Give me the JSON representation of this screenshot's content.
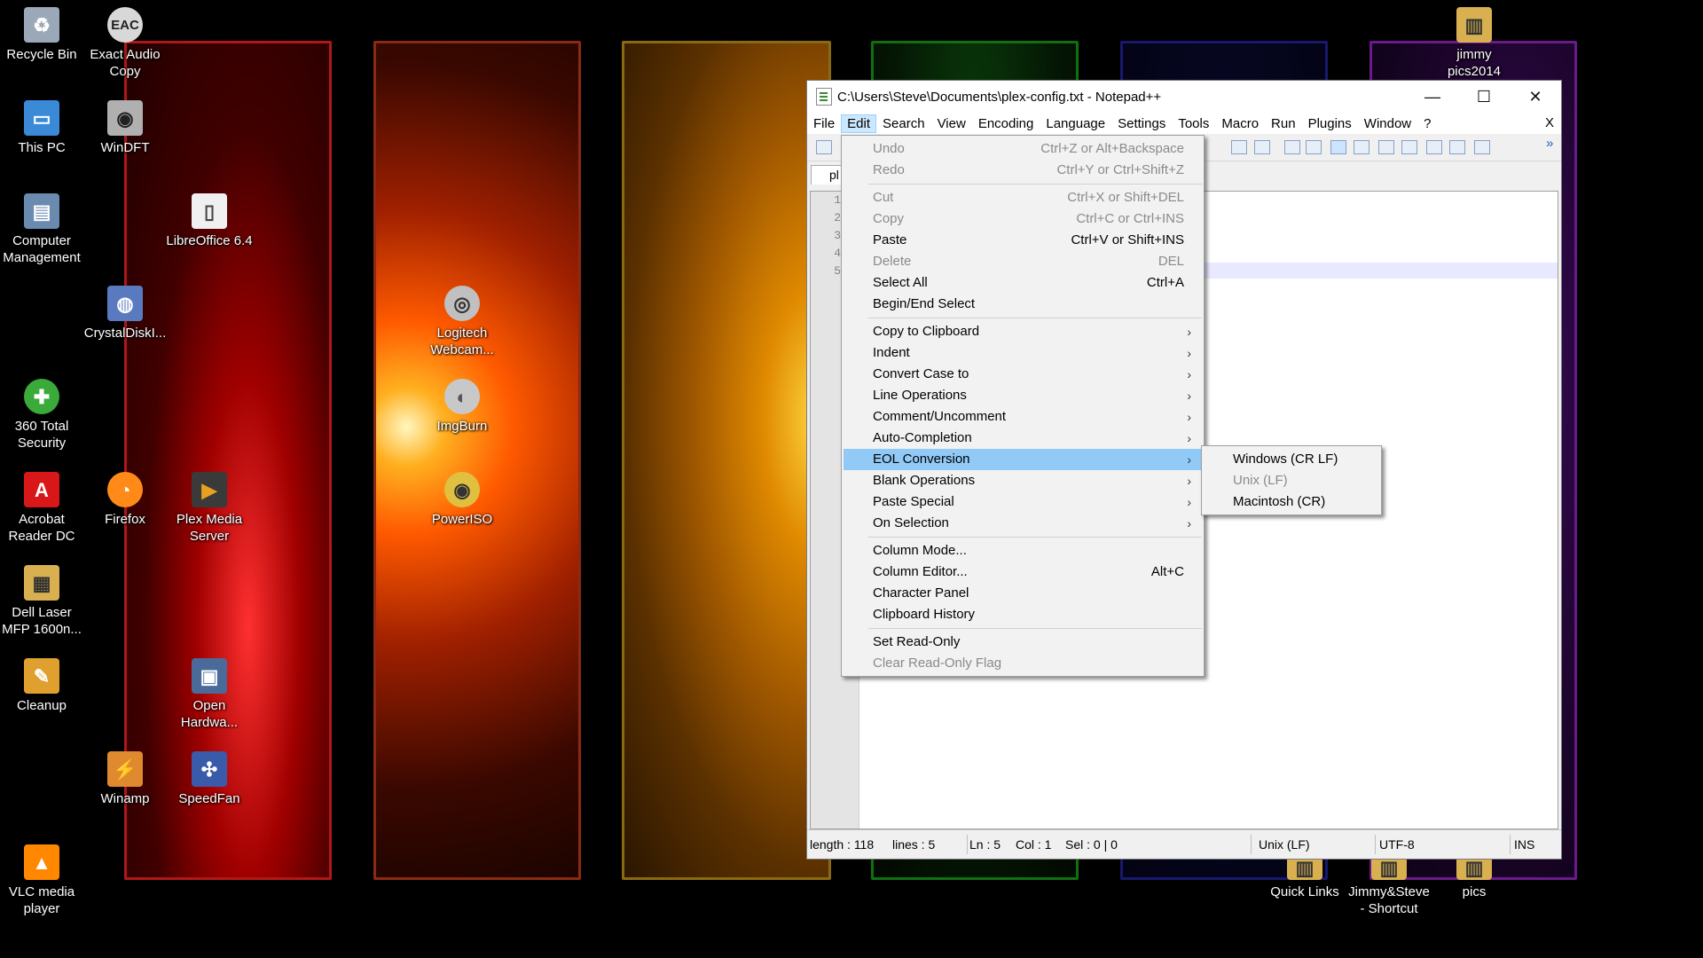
{
  "desktop": {
    "icons": [
      {
        "label": "Recycle Bin",
        "icon": "recycle-bin-icon",
        "color": "#9aa8b8",
        "glyph": "♻"
      },
      {
        "label": "Exact Audio Copy",
        "icon": "eac-icon",
        "color": "#d8d8d8",
        "glyph": "EAC"
      },
      {
        "label": "This PC",
        "icon": "computer-icon",
        "color": "#3a8ad8",
        "glyph": "▭"
      },
      {
        "label": "WinDFT",
        "icon": "windft-icon",
        "color": "#b0b0b0",
        "glyph": "◉"
      },
      {
        "label": "Computer Management",
        "icon": "computer-management-icon",
        "color": "#6a8ab0",
        "glyph": "▤"
      },
      {
        "label": "LibreOffice 6.4",
        "icon": "libreoffice-icon",
        "color": "#f0f0f0",
        "glyph": "▯"
      },
      {
        "label": "CrystalDiskI...",
        "icon": "crystaldisk-icon",
        "color": "#5a7ac0",
        "glyph": "◍"
      },
      {
        "label": "Logitech Webcam...",
        "icon": "webcam-icon",
        "color": "#c0c0c0",
        "glyph": "◎"
      },
      {
        "label": "360 Total Security",
        "icon": "security-shield-icon",
        "color": "#3aaa3a",
        "glyph": "✚"
      },
      {
        "label": "ImgBurn",
        "icon": "disc-icon",
        "color": "#c8c8c8",
        "glyph": "◐"
      },
      {
        "label": "Acrobat Reader DC",
        "icon": "acrobat-icon",
        "color": "#d81818",
        "glyph": "A"
      },
      {
        "label": "Firefox",
        "icon": "firefox-icon",
        "color": "#ff8a18",
        "glyph": "◔"
      },
      {
        "label": "Plex Media Server",
        "icon": "plex-icon",
        "color": "#3a3a3a",
        "glyph": "▶"
      },
      {
        "label": "PowerISO",
        "icon": "poweriso-icon",
        "color": "#e0c040",
        "glyph": "◉"
      },
      {
        "label": "Dell Laser MFP 1600n...",
        "icon": "printer-folder-icon",
        "color": "#d8b050",
        "glyph": "▦"
      },
      {
        "label": "Cleanup",
        "icon": "broom-icon",
        "color": "#e0a030",
        "glyph": "✎"
      },
      {
        "label": "Open Hardwa...",
        "icon": "open-hardware-icon",
        "color": "#4a6a9a",
        "glyph": "▣"
      },
      {
        "label": "Winamp",
        "icon": "winamp-icon",
        "color": "#e08a30",
        "glyph": "⚡"
      },
      {
        "label": "SpeedFan",
        "icon": "speedfan-icon",
        "color": "#3a5aaa",
        "glyph": "✣"
      },
      {
        "label": "VLC media player",
        "icon": "vlc-icon",
        "color": "#ff8800",
        "glyph": "▲"
      },
      {
        "label": "jimmy pics2014",
        "icon": "folder-icon",
        "color": "#d8b050",
        "glyph": "▥"
      },
      {
        "label": "Quick Links",
        "icon": "folder-icon",
        "color": "#d8b050",
        "glyph": "▥"
      },
      {
        "label": "Jimmy&Steve - Shortcut",
        "icon": "folder-shortcut-icon",
        "color": "#d8b050",
        "glyph": "▥"
      },
      {
        "label": "pics",
        "icon": "folder-icon",
        "color": "#d8b050",
        "glyph": "▥"
      }
    ]
  },
  "window": {
    "title": "C:\\Users\\Steve\\Documents\\plex-config.txt - Notepad++",
    "minimize": "—",
    "maximize": "☐",
    "close": "✕",
    "menu": [
      "File",
      "Edit",
      "Search",
      "View",
      "Encoding",
      "Language",
      "Settings",
      "Tools",
      "Macro",
      "Run",
      "Plugins",
      "Window",
      "?"
    ],
    "close_doc": "X",
    "tab_label": "pl",
    "toolbar_overflow": "»",
    "line_numbers": [
      "1",
      "2",
      "3",
      "4",
      "5"
    ],
    "status": {
      "length": "length : 118",
      "lines": "lines : 5",
      "ln": "Ln : 5",
      "col": "Col : 1",
      "sel": "Sel : 0 | 0",
      "eol": "Unix (LF)",
      "encoding": "UTF-8",
      "mode": "INS"
    }
  },
  "edit_menu": {
    "items": [
      {
        "label": "Undo",
        "shortcut": "Ctrl+Z or Alt+Backspace",
        "disabled": true
      },
      {
        "label": "Redo",
        "shortcut": "Ctrl+Y or Ctrl+Shift+Z",
        "disabled": true
      },
      {
        "label": "Cut",
        "shortcut": "Ctrl+X or Shift+DEL",
        "disabled": true
      },
      {
        "label": "Copy",
        "shortcut": "Ctrl+C or Ctrl+INS",
        "disabled": true
      },
      {
        "label": "Paste",
        "shortcut": "Ctrl+V or Shift+INS",
        "disabled": false
      },
      {
        "label": "Delete",
        "shortcut": "DEL",
        "disabled": true
      },
      {
        "label": "Select All",
        "shortcut": "Ctrl+A",
        "disabled": false
      },
      {
        "label": "Begin/End Select",
        "shortcut": "",
        "disabled": false
      },
      {
        "label": "Copy to Clipboard",
        "submenu": true
      },
      {
        "label": "Indent",
        "submenu": true
      },
      {
        "label": "Convert Case to",
        "submenu": true
      },
      {
        "label": "Line Operations",
        "submenu": true
      },
      {
        "label": "Comment/Uncomment",
        "submenu": true
      },
      {
        "label": "Auto-Completion",
        "submenu": true
      },
      {
        "label": "EOL Conversion",
        "submenu": true,
        "highlighted": true
      },
      {
        "label": "Blank Operations",
        "submenu": true
      },
      {
        "label": "Paste Special",
        "submenu": true
      },
      {
        "label": "On Selection",
        "submenu": true
      },
      {
        "label": "Column Mode...",
        "shortcut": ""
      },
      {
        "label": "Column Editor...",
        "shortcut": "Alt+C"
      },
      {
        "label": "Character Panel",
        "shortcut": ""
      },
      {
        "label": "Clipboard History",
        "shortcut": ""
      },
      {
        "label": "Set Read-Only",
        "shortcut": ""
      },
      {
        "label": "Clear Read-Only Flag",
        "shortcut": "",
        "disabled": true
      }
    ]
  },
  "eol_submenu": {
    "items": [
      {
        "label": "Windows (CR LF)",
        "disabled": false
      },
      {
        "label": "Unix (LF)",
        "disabled": true
      },
      {
        "label": "Macintosh (CR)",
        "disabled": false
      }
    ]
  }
}
